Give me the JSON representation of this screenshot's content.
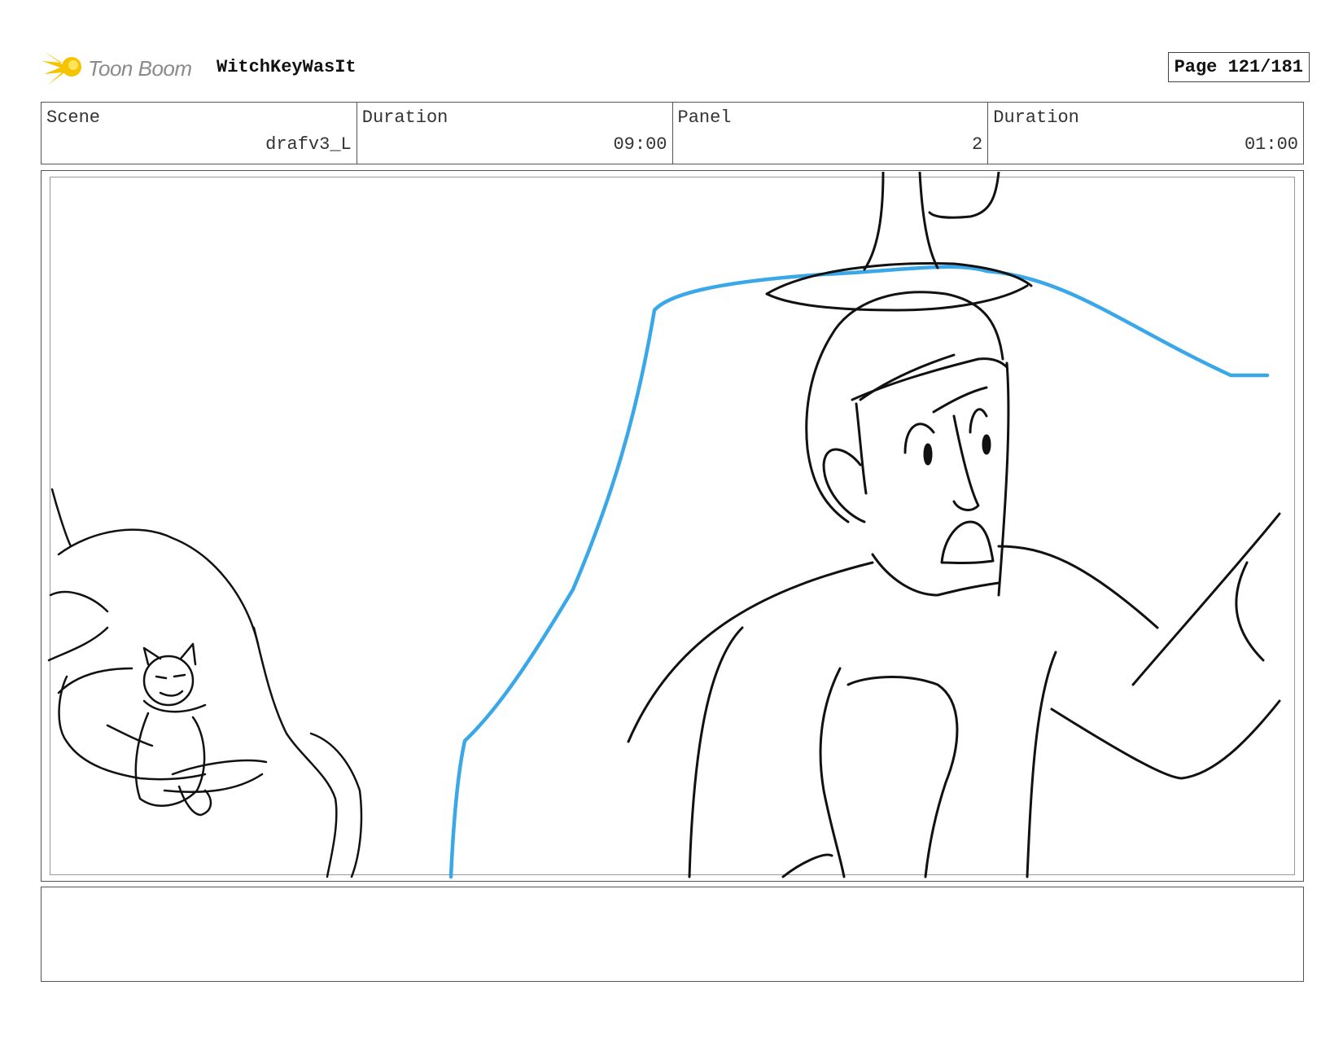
{
  "header": {
    "brand": "Toon Boom",
    "project_title": "WitchKeyWasIt",
    "page_label": "Page 121/181"
  },
  "info": {
    "scene_label": "Scene",
    "scene_value": "drafv3_L",
    "scene_duration_label": "Duration",
    "scene_duration_value": "09:00",
    "panel_label": "Panel",
    "panel_value": "2",
    "panel_duration_label": "Duration",
    "panel_duration_value": "01:00"
  },
  "notes": {
    "text": ""
  },
  "colors": {
    "sketch_line": "#111111",
    "guide_line": "#3aa8e8",
    "logo_yellow": "#f5c400"
  }
}
